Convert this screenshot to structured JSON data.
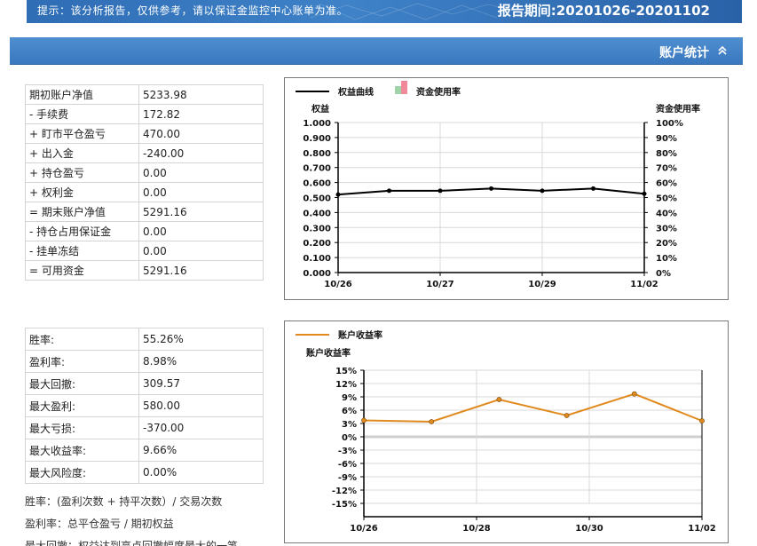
{
  "banner": {
    "notice": "提示：该分析报告，仅供参考，请以保证金监控中心账单为准。",
    "period": "报告期间:20201026-20201102"
  },
  "section": {
    "title": "账户统计",
    "chevron_icon": "double-chevron-up-icon"
  },
  "account_table": [
    {
      "label": "期初账户净值",
      "value": "5233.98"
    },
    {
      "label": "- 手续费",
      "value": "172.82"
    },
    {
      "label": "+ 盯市平仓盈亏",
      "value": "470.00"
    },
    {
      "label": "+ 出入金",
      "value": "-240.00"
    },
    {
      "label": "+ 持仓盈亏",
      "value": "0.00"
    },
    {
      "label": "+ 权利金",
      "value": "0.00"
    },
    {
      "label": "= 期末账户净值",
      "value": "5291.16"
    },
    {
      "label": "- 持仓占用保证金",
      "value": "0.00"
    },
    {
      "label": "- 挂单冻结",
      "value": "0.00"
    },
    {
      "label": "= 可用资金",
      "value": "5291.16"
    }
  ],
  "ratio_table": [
    {
      "label": "胜率:",
      "value": "55.26%"
    },
    {
      "label": "盈利率:",
      "value": "8.98%"
    },
    {
      "label": "最大回撤:",
      "value": "309.57"
    },
    {
      "label": "最大盈利:",
      "value": "580.00"
    },
    {
      "label": "最大亏损:",
      "value": "-370.00"
    },
    {
      "label": "最大收益率:",
      "value": "9.66%"
    },
    {
      "label": "最大风险度:",
      "value": "0.00%"
    }
  ],
  "notes": [
    "胜率：(盈利次数 + 持平次数）/ 交易次数",
    "盈利率：总平仓盈亏 / 期初权益",
    "最大回撤：权益达到高点回撤幅度最大的一笔"
  ],
  "colors": {
    "banner": "#3f82c8",
    "section_bar": "#3a78bf",
    "equity_line": "#000000",
    "return_line": "#e08a1e",
    "usage_legend_a": "#9fd3a8",
    "usage_legend_b": "#f08a9a"
  },
  "chart_data": [
    {
      "type": "line",
      "legend": [
        "权益曲线",
        "资金使用率"
      ],
      "ylabel": "权益",
      "y2label": "资金使用率",
      "ylim": [
        0,
        1
      ],
      "yticks": [
        "0.000",
        "0.100",
        "0.200",
        "0.300",
        "0.400",
        "0.500",
        "0.600",
        "0.700",
        "0.800",
        "0.900",
        "1.000"
      ],
      "y2ticks": [
        "0%",
        "10%",
        "20%",
        "30%",
        "40%",
        "50%",
        "60%",
        "70%",
        "80%",
        "90%",
        "100%"
      ],
      "xticks": [
        "10/26",
        "10/27",
        "10/29",
        "11/02"
      ],
      "series": [
        {
          "name": "权益曲线",
          "values": [
            0.52,
            0.545,
            0.545,
            0.56,
            0.545,
            0.56,
            0.525
          ]
        }
      ],
      "grid": true
    },
    {
      "type": "line",
      "legend": [
        "账户收益率"
      ],
      "ylabel": "账户收益率",
      "ylim": [
        -15,
        15
      ],
      "yticks": [
        "15%",
        "12%",
        "9%",
        "6%",
        "3%",
        "0%",
        "-3%",
        "-6%",
        "-9%",
        "-12%",
        "-15%"
      ],
      "xticks": [
        "10/26",
        "10/28",
        "10/30",
        "11/02"
      ],
      "series": [
        {
          "name": "账户收益率",
          "values": [
            3.7,
            3.4,
            8.4,
            4.8,
            9.66,
            3.6
          ]
        }
      ],
      "grid": true
    }
  ]
}
